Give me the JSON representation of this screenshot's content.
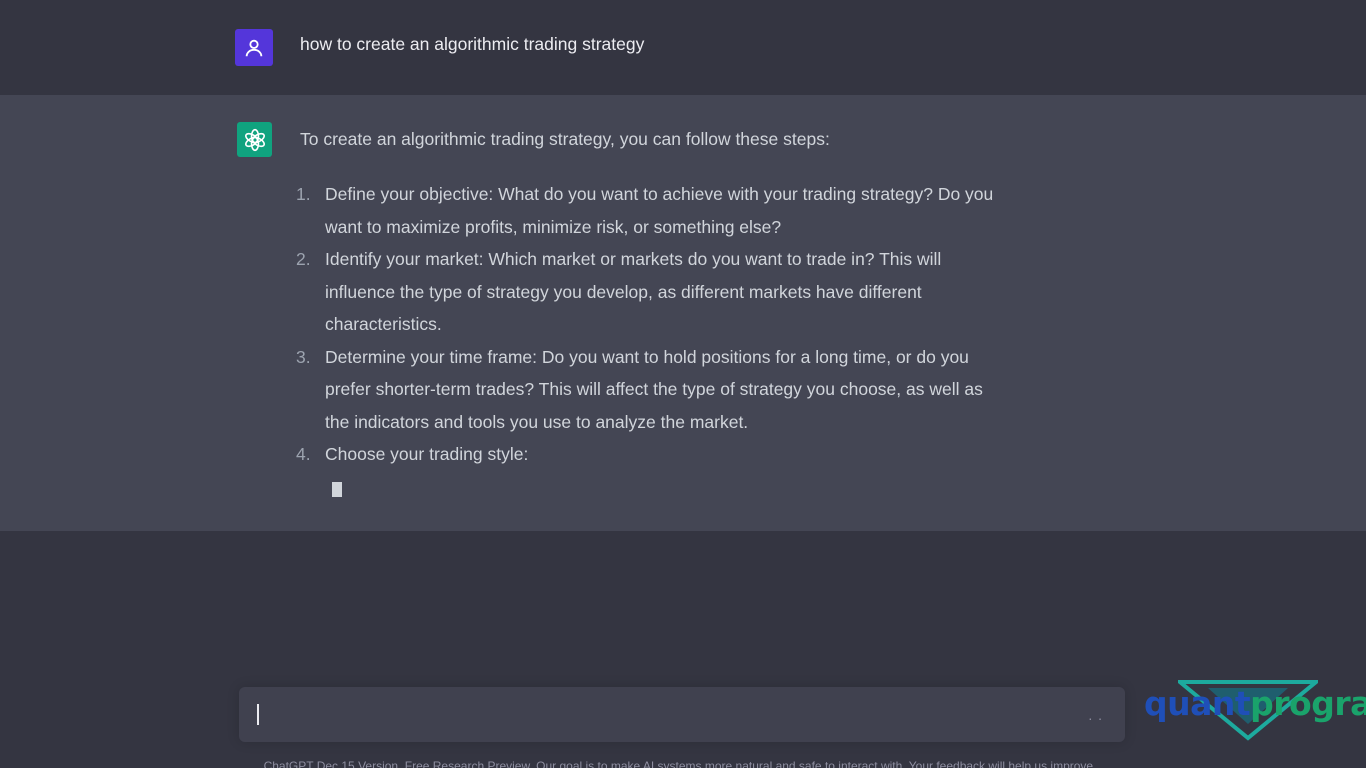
{
  "user_message": {
    "avatar_icon": "user-icon",
    "text": "how to create an algorithmic trading strategy"
  },
  "assistant_message": {
    "avatar_icon": "openai-logo-icon",
    "intro": "To create an algorithmic trading strategy, you can follow these steps:",
    "steps": [
      {
        "num": "1.",
        "lines": [
          "Define your objective: What do you want to achieve with your trading strategy? Do you",
          "want to maximize profits, minimize risk, or something else?"
        ]
      },
      {
        "num": "2.",
        "lines": [
          "Identify your market: Which market or markets do you want to trade in? This will",
          "influence the type of strategy you develop, as different markets have different",
          "characteristics."
        ]
      },
      {
        "num": "3.",
        "lines": [
          "Determine your time frame: Do you want to hold positions for a long time, or do you",
          "prefer shorter-term trades? This will affect the type of strategy you choose, as well as",
          "the indicators and tools you use to analyze the market."
        ]
      },
      {
        "num": "4.",
        "lines": [
          "Choose your trading style:"
        ]
      }
    ]
  },
  "input": {
    "value": "",
    "placeholder": "",
    "send_indicator": ". ."
  },
  "footer": {
    "text": "ChatGPT Dec 15 Version. Free Research Preview. Our goal is to make AI systems more natural and safe to interact with. Your feedback will help us improve."
  },
  "watermark": {
    "part1": "quant",
    "part2": "program"
  },
  "colors": {
    "background": "#343541",
    "assistant_background": "#444654",
    "user_avatar": "#5436da",
    "assistant_avatar": "#10a37f",
    "watermark_blue": "#1f4fb8",
    "watermark_green": "#1aa36b"
  }
}
